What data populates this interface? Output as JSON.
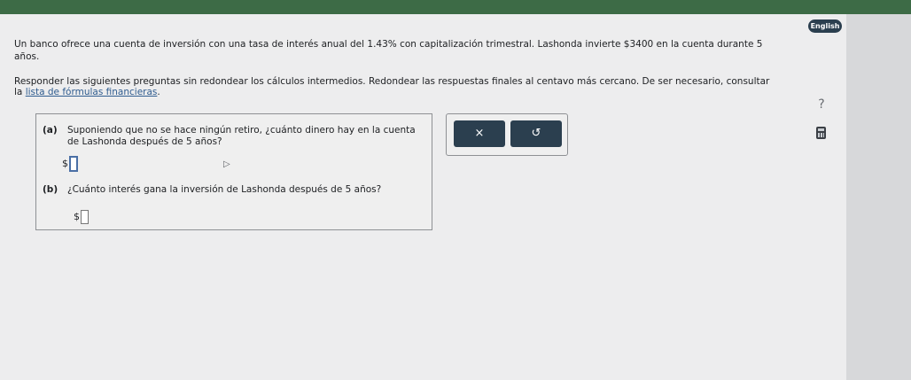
{
  "language_button": "English",
  "problem": {
    "line1": "Un banco ofrece una cuenta de inversión con una tasa de interés anual del 1.43% con capitalización trimestral. Lashonda invierte $3400 en la cuenta durante 5",
    "line2": "años."
  },
  "instructions": {
    "line1": "Responder las siguientes preguntas sin redondear los cálculos intermedios. Redondear las respuestas finales al centavo más cercano. De ser necesario, consultar",
    "prefix": "la ",
    "link": "lista de fórmulas financieras",
    "suffix": "."
  },
  "help_symbol": "?",
  "questions": [
    {
      "label": "(a)",
      "text": "Suponiendo que no se hace ningún retiro, ¿cuánto dinero hay en la cuenta de Lashonda después de 5 años?",
      "currency": "$",
      "value": ""
    },
    {
      "label": "(b)",
      "text": "¿Cuánto interés gana la inversión de Lashonda después de 5 años?",
      "currency": "$",
      "value": ""
    }
  ],
  "tools": {
    "clear_symbol": "×",
    "undo_symbol": "↺"
  },
  "icons": {
    "help": "question-mark-icon",
    "calculator": "calculator-icon",
    "cursor": "mouse-pointer-icon"
  },
  "colors": {
    "top_bar": "#3d6b46",
    "button_dark": "#2b3f4f",
    "link": "#2f5c8f"
  }
}
